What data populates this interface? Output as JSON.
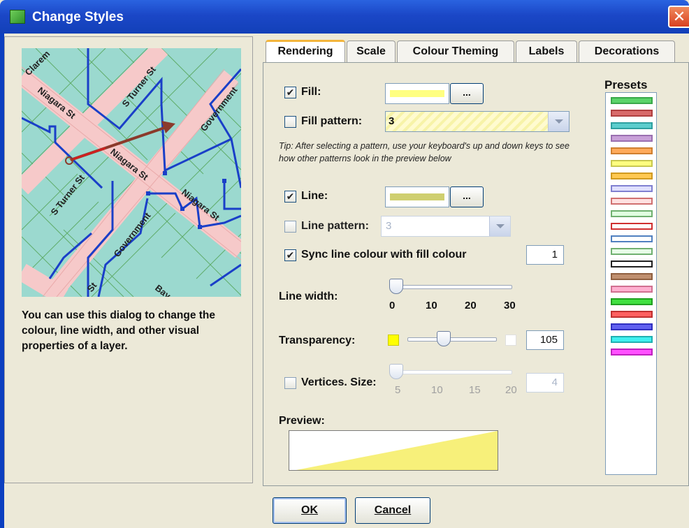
{
  "window": {
    "title": "Change Styles",
    "close_label": "✕"
  },
  "left_pane": {
    "description": "You can use this dialog to change the colour, line width, and other visual properties of a layer.",
    "map_labels": [
      "Clarem",
      "Niagara St",
      "S Turner St",
      "Government",
      "S Turner St",
      "Niagara St",
      "Niagara St",
      "Government",
      "St",
      "Bay"
    ]
  },
  "tabs": [
    {
      "label": "Rendering",
      "active": true
    },
    {
      "label": "Scale",
      "active": false
    },
    {
      "label": "Colour Theming",
      "active": false
    },
    {
      "label": "Labels",
      "active": false
    },
    {
      "label": "Decorations",
      "active": false
    }
  ],
  "rendering": {
    "fill": {
      "label": "Fill:",
      "checked": true,
      "check_mark": "✔",
      "color": "#ffff80",
      "button_label": "..."
    },
    "fill_pattern": {
      "label": "Fill pattern:",
      "checked": false,
      "value": "3"
    },
    "tip": "Tip: After selecting a pattern, use your keyboard's up and down keys to see how other patterns look in the preview below",
    "line": {
      "label": "Line:",
      "checked": true,
      "check_mark": "✔",
      "color": "#cfcf70",
      "button_label": "..."
    },
    "line_pattern": {
      "label": "Line pattern:",
      "checked": false,
      "value": "3"
    },
    "sync": {
      "label": "Sync line colour with fill colour",
      "checked": true,
      "check_mark": "✔",
      "value": "1"
    },
    "line_width": {
      "label": "Line width:",
      "ticks": [
        "0",
        "10",
        "20",
        "30"
      ],
      "value": 0
    },
    "transparency": {
      "label": "Transparency:",
      "value": "105",
      "swatch_color": "#ffff00"
    },
    "vertices": {
      "label": "Vertices. Size:",
      "checked": false,
      "ticks": [
        "5",
        "10",
        "15",
        "20"
      ],
      "value": "4"
    },
    "preview_label": "Preview:",
    "preview_fill": "#f7f07a"
  },
  "presets": {
    "label": "Presets",
    "items": [
      {
        "fill": "#5bd46a",
        "stroke": "#3aa84a"
      },
      {
        "fill": "#d86a6a",
        "stroke": "#b04040"
      },
      {
        "fill": "#5ccdcd",
        "stroke": "#2fa0a0"
      },
      {
        "fill": "#c8a0d8",
        "stroke": "#9a70b0"
      },
      {
        "fill": "#ffaa5a",
        "stroke": "#d08030"
      },
      {
        "fill": "#ffff80",
        "stroke": "#c8c850"
      },
      {
        "fill": "#ffc850",
        "stroke": "#d09a20"
      },
      {
        "fill": "#e0e0ff",
        "stroke": "#8080d0"
      },
      {
        "fill": "#ffe0e0",
        "stroke": "#d07070"
      },
      {
        "fill": "#e0ffe0",
        "stroke": "#70b070"
      },
      {
        "fill": "#ffffff",
        "stroke": "#d03030"
      },
      {
        "fill": "#ffffff",
        "stroke": "#5080c0"
      },
      {
        "fill": "#e8ffe8",
        "stroke": "#70b070"
      },
      {
        "fill": "#ffffff",
        "stroke": "#202020"
      },
      {
        "fill": "#c09070",
        "stroke": "#906040"
      },
      {
        "fill": "#ffb0d0",
        "stroke": "#d07090"
      },
      {
        "fill": "#40e040",
        "stroke": "#20a020"
      },
      {
        "fill": "#ff6060",
        "stroke": "#c03030"
      },
      {
        "fill": "#6060f0",
        "stroke": "#3030c0"
      },
      {
        "fill": "#40f0f0",
        "stroke": "#20b0b0"
      },
      {
        "fill": "#ff50ff",
        "stroke": "#c020c0"
      }
    ]
  },
  "buttons": {
    "ok": "OK",
    "cancel": "Cancel"
  },
  "colors": {
    "titlebar": "#1b47c7",
    "dialog_bg": "#ece9d8",
    "map_blue_line": "#1a3fc8",
    "map_road": "#f6c9c9",
    "map_water": "#9bd9cf"
  }
}
